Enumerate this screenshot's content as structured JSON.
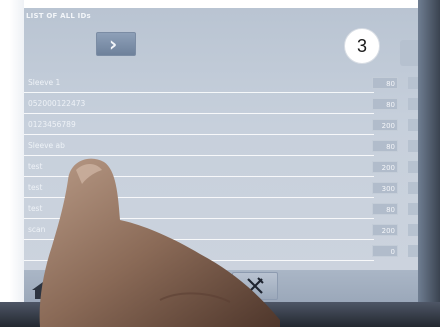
{
  "screen": {
    "title": "LIST OF ALL IDs",
    "page_badge": "3"
  },
  "rows": [
    {
      "label": "Sleeve 1",
      "value": "80"
    },
    {
      "label": "052000122473",
      "value": "80"
    },
    {
      "label": "0123456789",
      "value": "200"
    },
    {
      "label": "Sleeve ab",
      "value": "80"
    },
    {
      "label": "test",
      "value": "200"
    },
    {
      "label": "test",
      "value": "300"
    },
    {
      "label": "test",
      "value": "80"
    },
    {
      "label": "scan",
      "value": "200"
    },
    {
      "label": "",
      "value": "0"
    }
  ],
  "icons": {
    "next": "chevron-right-icon",
    "home": "home-icon",
    "tools": "tools-icon"
  },
  "colors": {
    "screen_bg": "#c7d0dc",
    "button": "#7b8ca4"
  }
}
